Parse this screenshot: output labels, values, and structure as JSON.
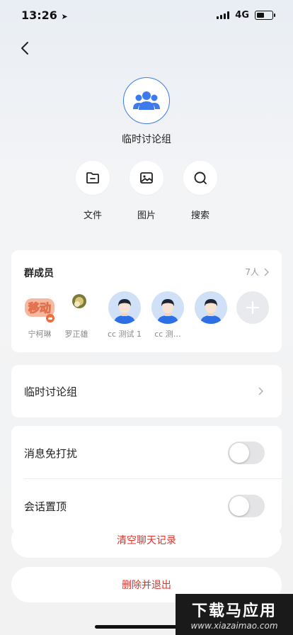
{
  "status_bar": {
    "time": "13:26",
    "network": "4G"
  },
  "group": {
    "name": "临时讨论组"
  },
  "actions": [
    {
      "label": "文件",
      "icon": "folder-icon"
    },
    {
      "label": "图片",
      "icon": "image-icon"
    },
    {
      "label": "搜索",
      "icon": "search-icon"
    }
  ],
  "members": {
    "title": "群成员",
    "count": "7人",
    "list": [
      {
        "name": "宁柯琳",
        "avatar": "custom-sticker-avatar"
      },
      {
        "name": "罗正雄",
        "avatar": "small-photo-avatar"
      },
      {
        "name": "cc 测试 1",
        "avatar": "default-person-avatar"
      },
      {
        "name": "cc 测…",
        "avatar": "default-person-avatar"
      },
      {
        "name": "",
        "avatar": "default-person-avatar"
      }
    ],
    "add_icon": "plus-icon"
  },
  "group_name_row": {
    "label": "临时讨论组"
  },
  "settings": {
    "mute_label": "消息免打扰",
    "mute_on": false,
    "pin_label": "会话置顶",
    "pin_on": false
  },
  "buttons": {
    "clear_history": "清空聊天记录",
    "delete_exit": "删除并退出"
  },
  "watermark": {
    "title": "下载马应用",
    "url": "www.xiazaimao.com"
  },
  "colors": {
    "accent": "#3d7bec",
    "danger": "#e0322a",
    "background": "#f2f2f2"
  }
}
